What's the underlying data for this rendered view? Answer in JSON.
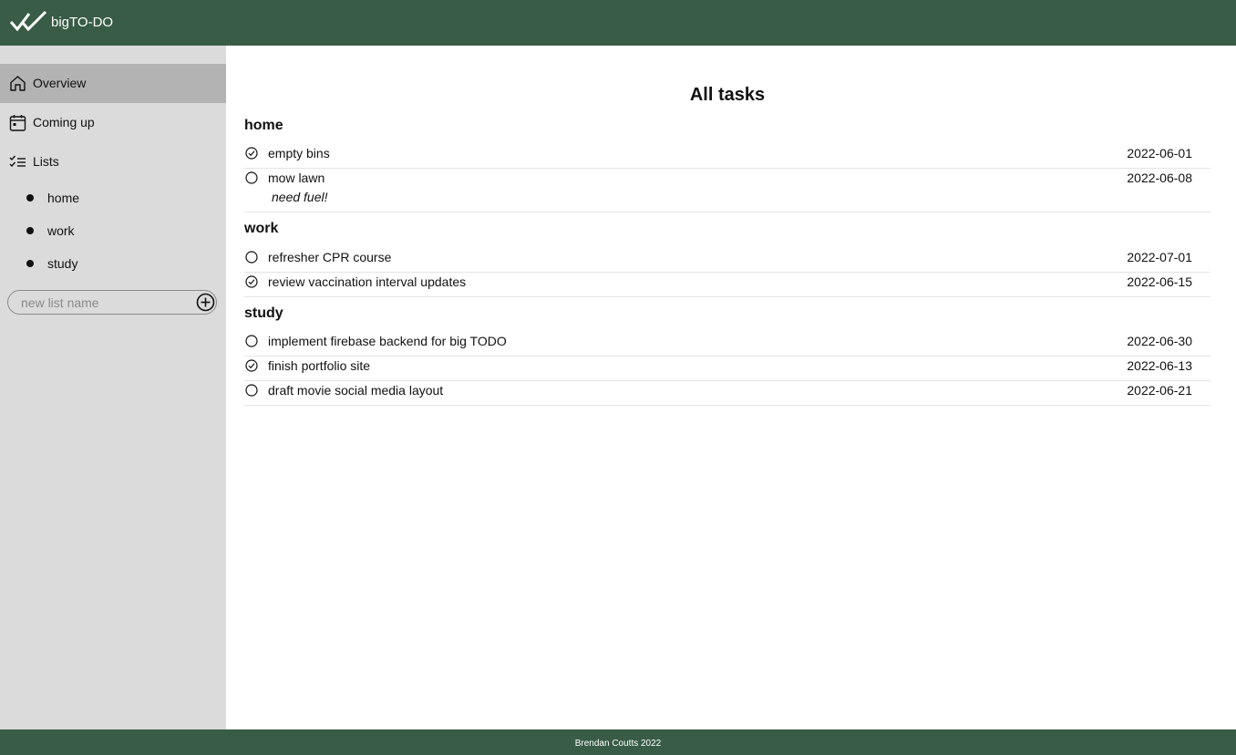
{
  "app": {
    "title": "bigTO-DO",
    "brand_color": "#385c45",
    "sidebar_color": "#dcdbdb",
    "active_color": "#b3b3b3"
  },
  "sidebar": {
    "nav": [
      {
        "label": "Overview",
        "icon": "home-icon",
        "active": true
      },
      {
        "label": "Coming up",
        "icon": "calendar-icon",
        "active": false
      },
      {
        "label": "Lists",
        "icon": "checklist-icon",
        "active": false
      }
    ],
    "lists": [
      {
        "label": "home"
      },
      {
        "label": "work"
      },
      {
        "label": "study"
      }
    ],
    "new_list": {
      "placeholder": "new list name",
      "value": ""
    }
  },
  "main": {
    "title": "All tasks",
    "groups": [
      {
        "name": "home",
        "tasks": [
          {
            "title": "empty bins",
            "date": "2022-06-01",
            "done": true
          },
          {
            "title": "mow lawn",
            "date": "2022-06-08",
            "done": false,
            "note": "need fuel!"
          }
        ]
      },
      {
        "name": "work",
        "tasks": [
          {
            "title": "refresher CPR course",
            "date": "2022-07-01",
            "done": false
          },
          {
            "title": "review vaccination interval updates",
            "date": "2022-06-15",
            "done": true
          }
        ]
      },
      {
        "name": "study",
        "tasks": [
          {
            "title": "implement firebase backend for big TODO",
            "date": "2022-06-30",
            "done": false
          },
          {
            "title": "finish portfolio site",
            "date": "2022-06-13",
            "done": true
          },
          {
            "title": "draft movie social media layout",
            "date": "2022-06-21",
            "done": false
          }
        ]
      }
    ]
  },
  "footer": {
    "text": "Brendan Coutts 2022"
  }
}
